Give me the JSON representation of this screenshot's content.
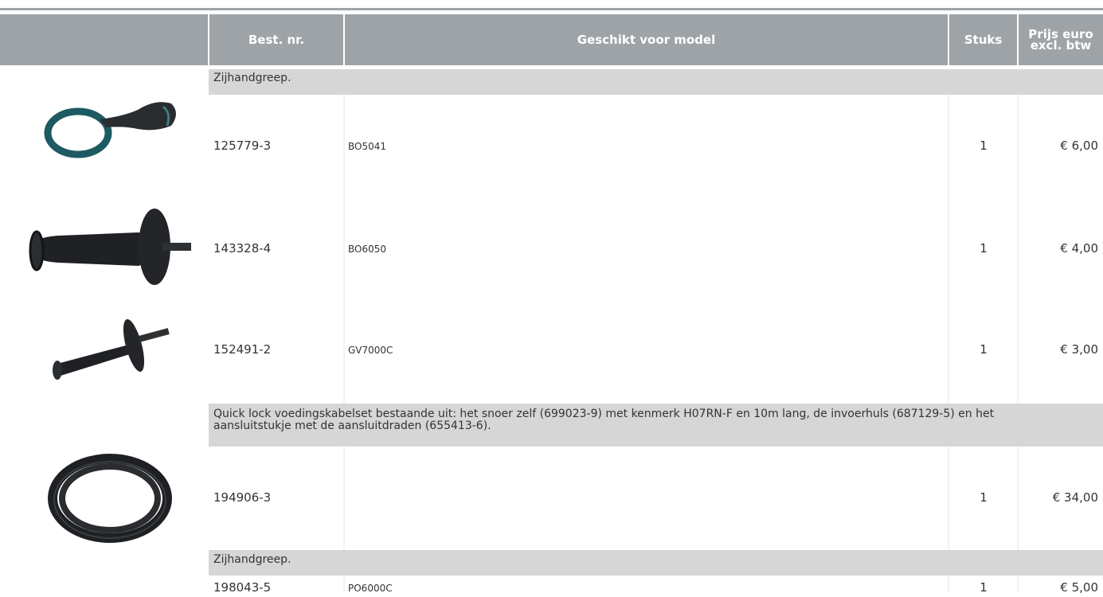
{
  "table": {
    "headers": {
      "image": "",
      "part_no": "Best. nr.",
      "model": "Geschikt voor model",
      "qty": "Stuks",
      "price_line1": "Prijs euro",
      "price_line2": "excl. btw"
    },
    "sections": [
      {
        "title": "Zijhandgreep.",
        "rows": [
          {
            "part_no": "125779-3",
            "model": "BO5041",
            "qty": "1",
            "price": "€ 6,00",
            "image": "side-handle-ring-icon"
          },
          {
            "part_no": "143328-4",
            "model": "BO6050",
            "qty": "1",
            "price": "€ 4,00",
            "image": "side-handle-large-icon"
          },
          {
            "part_no": "152491-2",
            "model": "GV7000C",
            "qty": "1",
            "price": "€ 3,00",
            "image": "side-handle-small-icon"
          }
        ]
      },
      {
        "title_line1": "Quick lock voedingskabelset bestaande uit: het snoer zelf (699023-9) met kenmerk H07RN-F en 10m lang, de invoerhuls (687129-5) en het",
        "title_line2": "aansluitstukje met de aansluitdraden (655413-6).",
        "rows": [
          {
            "part_no": "194906-3",
            "model": "",
            "qty": "1",
            "price": "€ 34,00",
            "image": "cable-coil-icon"
          }
        ]
      },
      {
        "title": "Zijhandgreep.",
        "rows": [
          {
            "part_no": "198043-5",
            "model": "PO6000C",
            "qty": "1",
            "price": "€ 5,00"
          }
        ]
      }
    ]
  },
  "colors": {
    "header_bg": "#9ea3a8",
    "band_bg": "#d6d6d6",
    "ring": "#1d5a62"
  }
}
